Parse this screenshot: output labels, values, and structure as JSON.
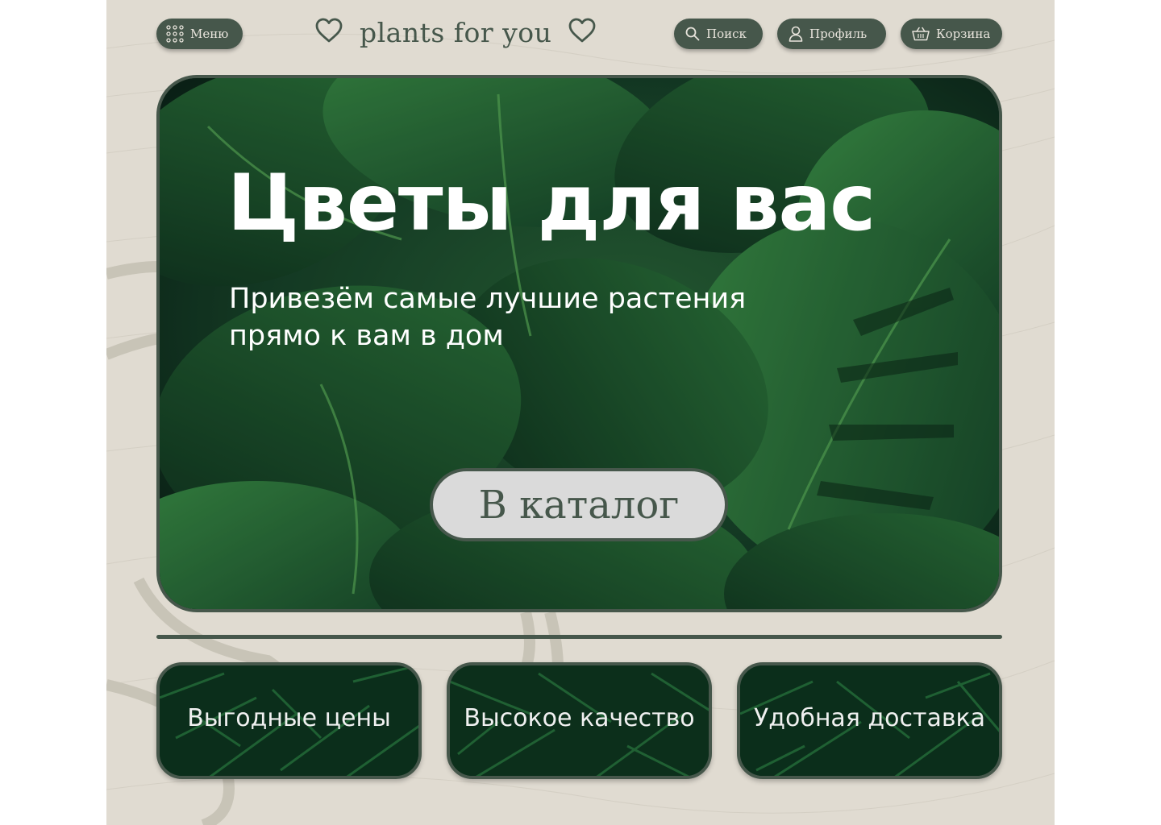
{
  "header": {
    "menu_label": "Меню",
    "logo_text": "plants for you",
    "search_label": "Поиск",
    "profile_label": "Профиль",
    "cart_label": "Корзина"
  },
  "hero": {
    "title": "Цветы для вас",
    "subtitle_line1": "Привезём самые лучшие растения",
    "subtitle_line2": "прямо к вам в дом",
    "cta_label": "В каталог"
  },
  "features": [
    {
      "label": "Выгодные цены"
    },
    {
      "label": "Высокое качество"
    },
    {
      "label": "Удобная доставка"
    }
  ],
  "colors": {
    "background": "#e0dbd1",
    "accent": "#46574b",
    "button_light": "#dadada",
    "text_light": "#ffffff"
  },
  "icons": {
    "menu": "grid-dots-icon",
    "logo_left": "heart-icon",
    "logo_right": "heart-icon",
    "search": "search-icon",
    "profile": "user-icon",
    "cart": "basket-icon"
  }
}
